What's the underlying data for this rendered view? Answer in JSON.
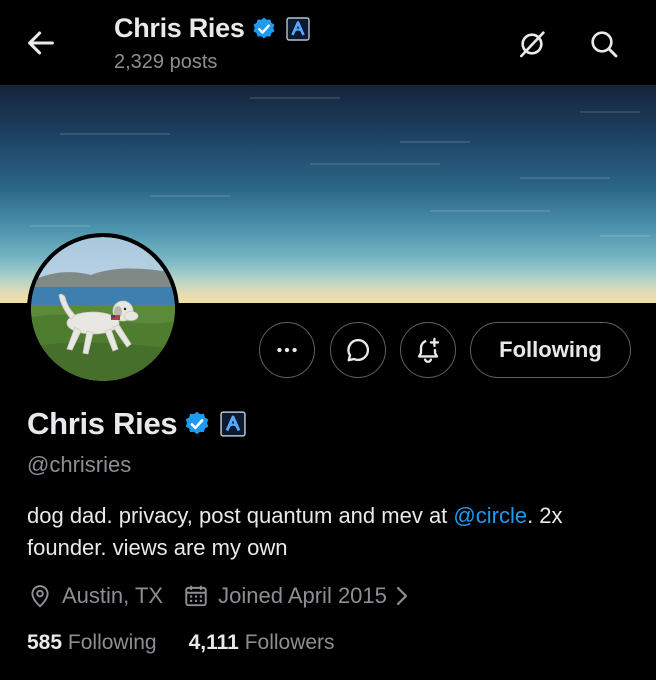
{
  "header": {
    "name": "Chris Ries",
    "posts": "2,329 posts"
  },
  "profile": {
    "name": "Chris Ries",
    "handle": "@chrisries",
    "bio_before": "dog dad. privacy, post quantum and mev at ",
    "bio_mention": "@circle",
    "bio_after": ". 2x founder. views are my own",
    "location": "Austin, TX",
    "joined": "Joined April 2015",
    "following_count": "585",
    "following_label": "Following",
    "followers_count": "4,111",
    "followers_label": "Followers"
  },
  "actions": {
    "follow_state_label": "Following"
  },
  "icons": [
    "back-arrow-icon",
    "verified-badge-icon",
    "affiliate-badge-icon",
    "no-grok-icon",
    "search-icon",
    "more-icon",
    "message-icon",
    "notify-bell-icon",
    "location-icon",
    "calendar-icon",
    "chevron-right-icon"
  ],
  "colors": {
    "background": "#000000",
    "text_primary": "#e7e9ea",
    "text_secondary": "#8b8f94",
    "accent": "#1d9bf0",
    "border": "#5b6166"
  }
}
